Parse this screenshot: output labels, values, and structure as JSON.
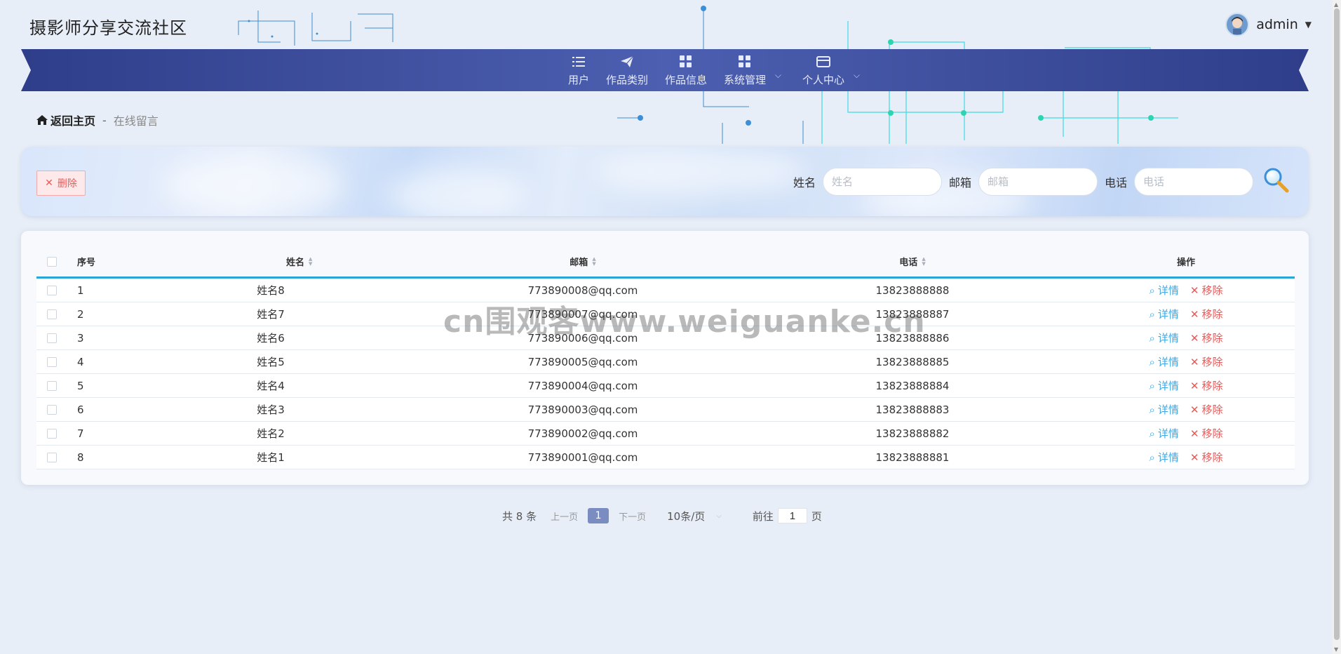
{
  "header": {
    "site_title": "摄影师分享交流社区",
    "user_name": "admin"
  },
  "nav": {
    "items": [
      {
        "label": "用户",
        "icon": "list-icon"
      },
      {
        "label": "作品类别",
        "icon": "paper-plane-icon"
      },
      {
        "label": "作品信息",
        "icon": "grid-icon"
      },
      {
        "label": "系统管理",
        "icon": "grid-icon",
        "dropdown": true
      },
      {
        "label": "个人中心",
        "icon": "card-icon",
        "dropdown": true
      }
    ]
  },
  "breadcrumb": {
    "home": "返回主页",
    "separator": "-",
    "current": "在线留言"
  },
  "toolbar": {
    "delete_label": "删除",
    "filters": [
      {
        "label": "姓名",
        "placeholder": "姓名"
      },
      {
        "label": "邮箱",
        "placeholder": "邮箱"
      },
      {
        "label": "电话",
        "placeholder": "电话"
      }
    ]
  },
  "table": {
    "columns": [
      "序号",
      "姓名",
      "邮箱",
      "电话",
      "操作"
    ],
    "rows": [
      {
        "idx": "1",
        "name": "姓名8",
        "email": "773890008@qq.com",
        "phone": "13823888888"
      },
      {
        "idx": "2",
        "name": "姓名7",
        "email": "773890007@qq.com",
        "phone": "13823888887"
      },
      {
        "idx": "3",
        "name": "姓名6",
        "email": "773890006@qq.com",
        "phone": "13823888886"
      },
      {
        "idx": "4",
        "name": "姓名5",
        "email": "773890005@qq.com",
        "phone": "13823888885"
      },
      {
        "idx": "5",
        "name": "姓名4",
        "email": "773890004@qq.com",
        "phone": "13823888884"
      },
      {
        "idx": "6",
        "name": "姓名3",
        "email": "773890003@qq.com",
        "phone": "13823888883"
      },
      {
        "idx": "7",
        "name": "姓名2",
        "email": "773890002@qq.com",
        "phone": "13823888882"
      },
      {
        "idx": "8",
        "name": "姓名1",
        "email": "773890001@qq.com",
        "phone": "13823888881"
      }
    ],
    "detail_label": "详情",
    "remove_label": "移除"
  },
  "pagination": {
    "total": "共 8 条",
    "prev": "上一页",
    "current_page": "1",
    "next": "下一页",
    "page_size": "10条/页",
    "goto_label": "前往",
    "goto_value": "1",
    "goto_suffix": "页"
  },
  "watermark": "cn围观客www.weiguanke.cn",
  "colors": {
    "nav_band": "#3f4f9e",
    "accent_line": "#2aa5d8",
    "detail": "#3ea7e0",
    "remove": "#e45b5b",
    "page_active": "#7b8cc0"
  }
}
